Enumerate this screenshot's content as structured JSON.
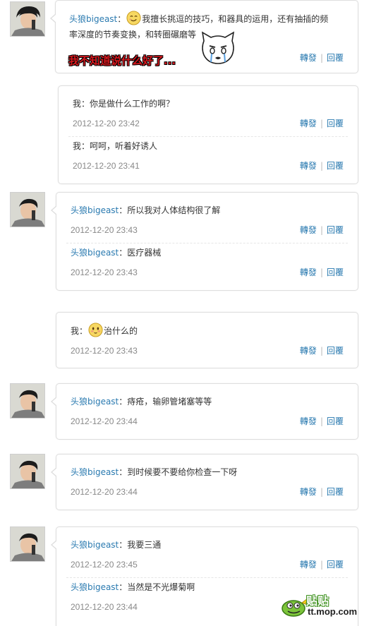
{
  "colors": {
    "link": "#2a7ab0",
    "time": "#888888",
    "sticker_text": "#d7181e"
  },
  "threads": [
    {
      "comments": [
        {
          "user": "头狼bigeast",
          "sep": "：",
          "text_a": "我擅长挑逗的技巧，和器具的运用，还有抽插的频",
          "text_b": "率深度的节奏变换，和转圈碾磨等",
          "emoji": "smirk-face-icon",
          "repost": "轉發",
          "reply": "回覆"
        }
      ],
      "sticker_text": "我不知道说什么好了..."
    },
    {
      "comments": [
        {
          "user": "我",
          "sep": "：",
          "text": "你是做什么工作的啊？",
          "time": "2012-12-20 23:42",
          "repost": "轉發",
          "reply": "回覆"
        },
        {
          "user": "我",
          "sep": "：",
          "text": "呵呵，听着好诱人",
          "time": "2012-12-20 23:41",
          "repost": "轉發",
          "reply": "回覆"
        }
      ]
    },
    {
      "comments": [
        {
          "user": "头狼bigeast",
          "sep": "：",
          "text": "所以我对人体结构很了解",
          "time": "2012-12-20 23:43",
          "repost": "轉發",
          "reply": "回覆"
        },
        {
          "user": "头狼bigeast",
          "sep": "：",
          "text": "医疗器械",
          "time": "2012-12-20 23:43",
          "repost": "轉發",
          "reply": "回覆"
        }
      ]
    },
    {
      "comments": [
        {
          "user": "我",
          "sep": "：",
          "text": "治什么的",
          "time": "2012-12-20 23:43",
          "repost": "轉發",
          "reply": "回覆",
          "emoji": "shy-face-icon"
        }
      ]
    },
    {
      "comments": [
        {
          "user": "头狼bigeast",
          "sep": "：",
          "text": "痔疮，输卵管堵塞等等",
          "time": "2012-12-20 23:44",
          "repost": "轉發",
          "reply": "回覆"
        }
      ]
    },
    {
      "comments": [
        {
          "user": "头狼bigeast",
          "sep": "：",
          "text": "到时候要不要给你检查一下呀",
          "time": "2012-12-20 23:44",
          "repost": "轉發",
          "reply": "回覆"
        }
      ]
    },
    {
      "comments": [
        {
          "user": "头狼bigeast",
          "sep": "：",
          "text": "我要三通",
          "time": "2012-12-20 23:45",
          "repost": "轉發",
          "reply": "回覆"
        },
        {
          "user": "头狼bigeast",
          "sep": "：",
          "text": "当然是不光爆菊啊",
          "time": "2012-12-20 23:44",
          "repost": "",
          "reply": ""
        }
      ]
    }
  ],
  "watermark": {
    "cn": "贴贴",
    "url": "tt.mop.com"
  }
}
